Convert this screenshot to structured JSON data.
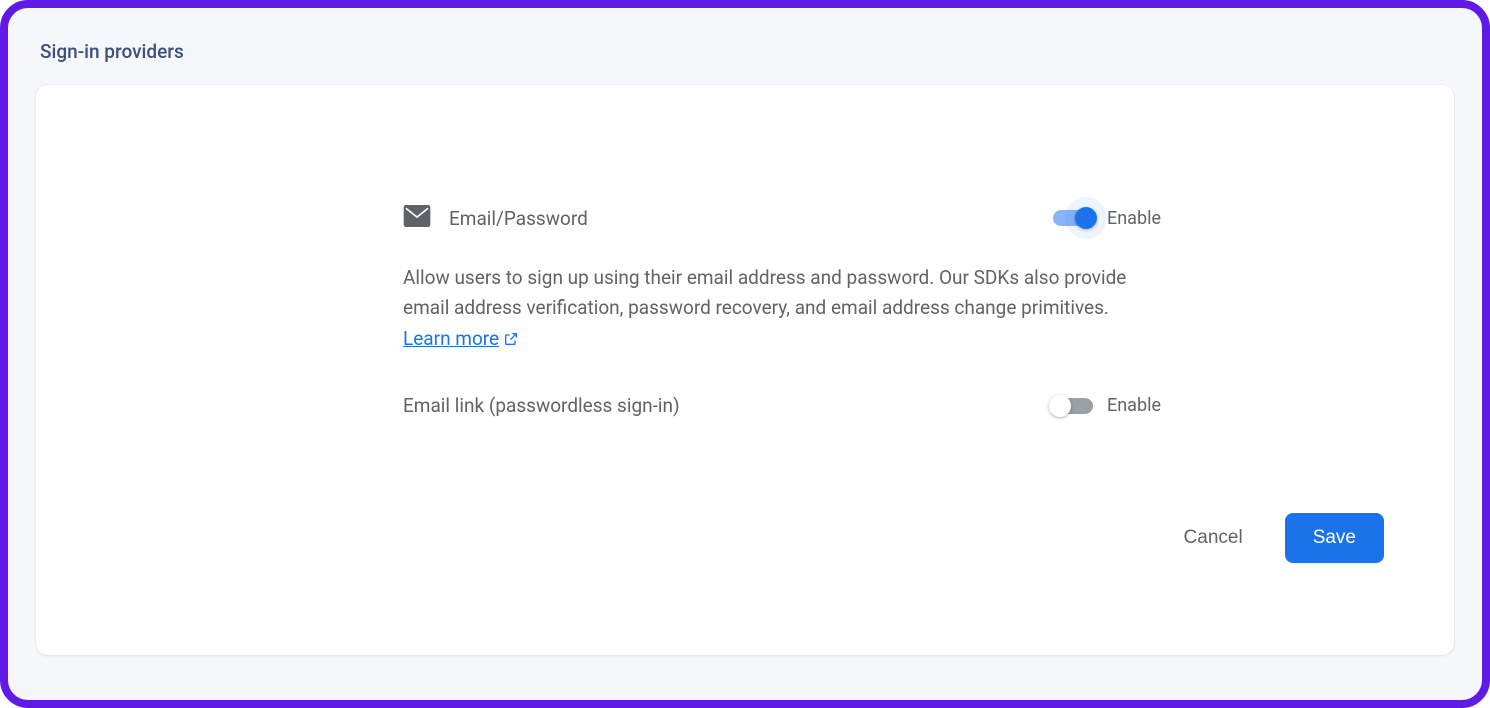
{
  "section_title": "Sign-in providers",
  "provider": {
    "primary": {
      "name": "Email/Password",
      "toggle_label": "Enable",
      "enabled": true
    },
    "description": "Allow users to sign up using their email address and password. Our SDKs also provide email address verification, password recovery, and email address change primitives. ",
    "learn_more": "Learn more",
    "secondary": {
      "name": "Email link (passwordless sign-in)",
      "toggle_label": "Enable",
      "enabled": false
    }
  },
  "actions": {
    "cancel": "Cancel",
    "save": "Save"
  }
}
